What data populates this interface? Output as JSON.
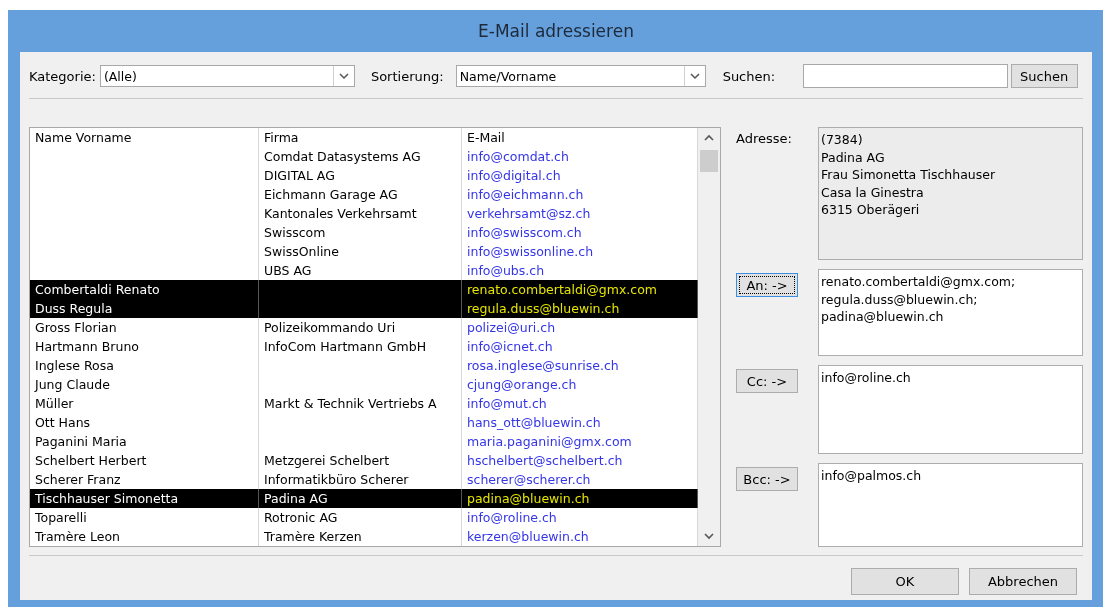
{
  "window": {
    "title": "E-Mail adressieren"
  },
  "filters": {
    "category_label": "Kategorie:",
    "category_value": "(Alle)",
    "sort_label": "Sortierung:",
    "sort_value": "Name/Vorname",
    "search_label": "Suchen:",
    "search_button": "Suchen"
  },
  "table": {
    "columns": [
      "Name Vorname",
      "Firma",
      "E-Mail"
    ],
    "rows": [
      {
        "name": "",
        "company": "Comdat Datasystems AG",
        "email": "info@comdat.ch",
        "selected": false
      },
      {
        "name": "",
        "company": "DIGITAL AG",
        "email": "info@digital.ch",
        "selected": false
      },
      {
        "name": "",
        "company": "Eichmann Garage AG",
        "email": "info@eichmann.ch",
        "selected": false
      },
      {
        "name": "",
        "company": "Kantonales Verkehrsamt",
        "email": "verkehrsamt@sz.ch",
        "selected": false
      },
      {
        "name": "",
        "company": "Swisscom",
        "email": "info@swisscom.ch",
        "selected": false
      },
      {
        "name": "",
        "company": "SwissOnline",
        "email": "info@swissonline.ch",
        "selected": false
      },
      {
        "name": "",
        "company": "UBS AG",
        "email": "info@ubs.ch",
        "selected": false
      },
      {
        "name": "Combertaldi Renato",
        "company": "",
        "email": "renato.combertaldi@gmx.com",
        "selected": true
      },
      {
        "name": "Duss Regula",
        "company": "",
        "email": "regula.duss@bluewin.ch",
        "selected": true
      },
      {
        "name": "Gross Florian",
        "company": "Polizeikommando Uri",
        "email": "polizei@uri.ch",
        "selected": false
      },
      {
        "name": "Hartmann Bruno",
        "company": "InfoCom Hartmann GmbH",
        "email": "info@icnet.ch",
        "selected": false
      },
      {
        "name": "Inglese Rosa",
        "company": "",
        "email": "rosa.inglese@sunrise.ch",
        "selected": false
      },
      {
        "name": "Jung Claude",
        "company": "",
        "email": "cjung@orange.ch",
        "selected": false
      },
      {
        "name": "Müller",
        "company": "Markt & Technik Vertriebs A",
        "email": "info@mut.ch",
        "selected": false
      },
      {
        "name": "Ott Hans",
        "company": "",
        "email": "hans_ott@bluewin.ch",
        "selected": false
      },
      {
        "name": "Paganini Maria",
        "company": "",
        "email": "maria.paganini@gmx.com",
        "selected": false
      },
      {
        "name": "Schelbert Herbert",
        "company": "Metzgerei Schelbert",
        "email": "hschelbert@schelbert.ch",
        "selected": false
      },
      {
        "name": "Scherer Franz",
        "company": "Informatikbüro Scherer",
        "email": "scherer@scherer.ch",
        "selected": false
      },
      {
        "name": "Tischhauser Simonetta",
        "company": "Padina AG",
        "email": "padina@bluewin.ch",
        "selected": true
      },
      {
        "name": "Toparelli",
        "company": "Rotronic AG",
        "email": "info@roline.ch",
        "selected": false
      },
      {
        "name": "Tramère Leon",
        "company": "Tramère Kerzen",
        "email": "kerzen@bluewin.ch",
        "selected": false
      }
    ]
  },
  "address": {
    "label": "Adresse:",
    "lines": [
      "(7384)",
      "Padina AG",
      "Frau Simonetta Tischhauser",
      "Casa la Ginestra",
      "6315 Oberägeri"
    ]
  },
  "recipients": [
    {
      "button": "An: ->",
      "focused": true,
      "lines": [
        "renato.combertaldi@gmx.com;",
        "regula.duss@bluewin.ch;",
        "padina@bluewin.ch"
      ]
    },
    {
      "button": "Cc: ->",
      "focused": false,
      "lines": [
        "info@roline.ch"
      ]
    },
    {
      "button": "Bcc: ->",
      "focused": false,
      "lines": [
        "info@palmos.ch"
      ]
    }
  ],
  "buttons": [
    "OK",
    "Abbrechen"
  ]
}
